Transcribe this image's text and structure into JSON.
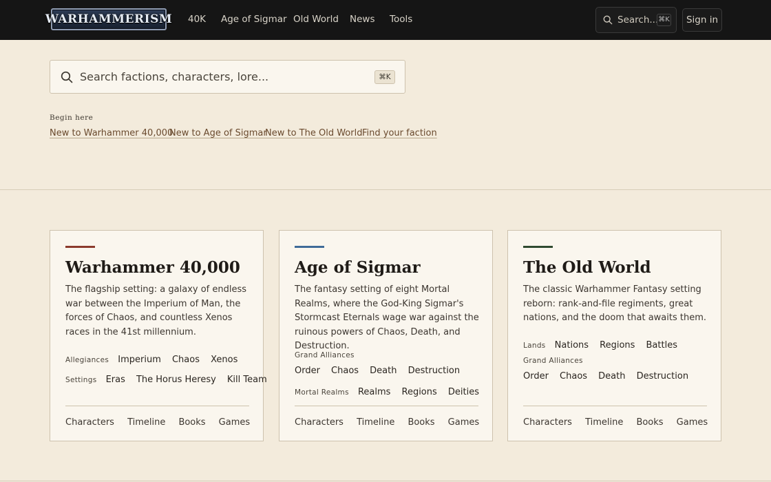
{
  "header": {
    "logo_text": "WARHAMMERISM",
    "nav": [
      "40K",
      "Age of Sigmar",
      "Old World",
      "News",
      "Tools"
    ],
    "search_label": "Search...",
    "search_shortcut": "⌘K",
    "signin_label": "Sign in"
  },
  "search": {
    "placeholder": "Search factions, characters, lore...",
    "shortcut": "⌘K"
  },
  "begin": {
    "label": "Begin here",
    "links": [
      "New to Warhammer 40,000",
      "New to Age of Sigmar",
      "New to The Old World",
      "Find your faction"
    ]
  },
  "cards": [
    {
      "title": "Warhammer 40,000",
      "accent": "#8b3a2c",
      "description": "The flagship setting: a galaxy of endless war between the Imperium of Man, the forces of Chaos, and countless Xenos races in the 41st millennium.",
      "rows": [
        {
          "label": "Allegiances",
          "tags": [
            "Imperium",
            "Chaos",
            "Xenos"
          ]
        },
        {
          "label": "Settings",
          "tags": [
            "Eras",
            "The Horus Heresy",
            "Kill Team"
          ]
        }
      ],
      "footer": [
        "Characters",
        "Timeline",
        "Books",
        "Games"
      ]
    },
    {
      "title": "Age of Sigmar",
      "accent": "#3f6b98",
      "description": "The fantasy setting of eight Mortal Realms, where the God-King Sigmar's Stormcast Eternals wage war against the ruinous powers of Chaos, Death, and Destruction.",
      "rows": [
        {
          "label": "Grand Alliances",
          "tags": [
            "Order",
            "Chaos",
            "Death",
            "Destruction"
          ]
        },
        {
          "label": "Mortal Realms",
          "tags": [
            "Realms",
            "Regions",
            "Deities"
          ]
        }
      ],
      "footer": [
        "Characters",
        "Timeline",
        "Books",
        "Games"
      ]
    },
    {
      "title": "The Old World",
      "accent": "#2f4a30",
      "description": "The classic Warhammer Fantasy setting reborn: rank-and-file regiments, great nations, and the doom that awaits them.",
      "rows": [
        {
          "label": "Lands",
          "tags": [
            "Nations",
            "Regions",
            "Battles"
          ]
        },
        {
          "label": "Grand Alliances",
          "tags": [
            "Order",
            "Chaos",
            "Death",
            "Destruction"
          ]
        }
      ],
      "footer": [
        "Characters",
        "Timeline",
        "Books",
        "Games"
      ]
    }
  ]
}
